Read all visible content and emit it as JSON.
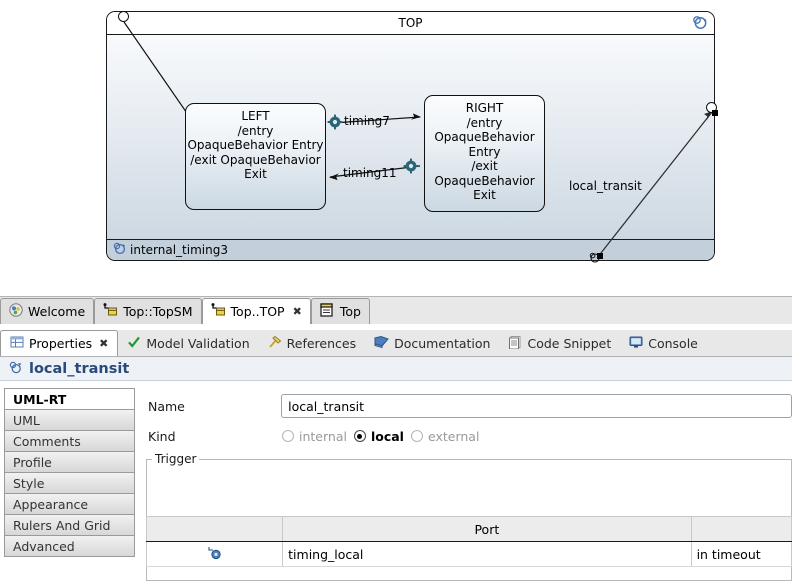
{
  "diagram": {
    "frame_title": "TOP",
    "frame_history_icon": "history-icon",
    "bottom_compartment": {
      "icon": "transition-icon",
      "label": "internal_timing3"
    },
    "states": [
      {
        "name": "state-left",
        "lines": [
          "LEFT",
          "/entry",
          "OpaqueBehavior Entry",
          "/exit OpaqueBehavior",
          "Exit"
        ]
      },
      {
        "name": "state-right",
        "lines": [
          "RIGHT",
          "/entry",
          "OpaqueBehavior",
          "Entry",
          "/exit",
          "OpaqueBehavior",
          "Exit"
        ]
      }
    ],
    "transitions": [
      {
        "label": "timing7",
        "icon": "gear-icon"
      },
      {
        "label": "timing11",
        "icon": "gear-icon"
      },
      {
        "label": "local_transit",
        "icon": "transition-icon",
        "selected": true
      }
    ],
    "initial_pseudostate": "initial-state-circle",
    "colors": {
      "frame_fill_top": "#fdfeff",
      "frame_fill_bottom": "#c3d0dc",
      "outline": "#1a1a1a",
      "gear": "#2b6676",
      "history": "#4a78b5"
    }
  },
  "editor_tabs": [
    {
      "label": "Welcome",
      "icon": "welcome-icon",
      "active": false,
      "closable": false
    },
    {
      "label": "Top::TopSM",
      "icon": "statemachine-icon",
      "active": false,
      "closable": false
    },
    {
      "label": "Top..TOP",
      "icon": "statemachine-icon",
      "active": true,
      "closable": true
    },
    {
      "label": "Top",
      "icon": "class-icon",
      "active": false,
      "closable": false
    }
  ],
  "properties_tabs": [
    {
      "label": "Properties",
      "icon": "properties-icon",
      "active": true,
      "closable": true
    },
    {
      "label": "Model Validation",
      "icon": "check-icon",
      "active": false,
      "closable": false
    },
    {
      "label": "References",
      "icon": "references-icon",
      "active": false,
      "closable": false
    },
    {
      "label": "Documentation",
      "icon": "book-icon",
      "active": false,
      "closable": false
    },
    {
      "label": "Code Snippet",
      "icon": "code-icon",
      "active": false,
      "closable": false
    },
    {
      "label": "Console",
      "icon": "console-icon",
      "active": false,
      "closable": false
    }
  ],
  "properties": {
    "header": {
      "icon": "transition-icon",
      "title": "local_transit"
    },
    "side_tabs": [
      {
        "label": "UML-RT",
        "selected": true
      },
      {
        "label": "UML",
        "selected": false
      },
      {
        "label": "Comments",
        "selected": false
      },
      {
        "label": "Profile",
        "selected": false
      },
      {
        "label": "Style",
        "selected": false
      },
      {
        "label": "Appearance",
        "selected": false
      },
      {
        "label": "Rulers And Grid",
        "selected": false
      },
      {
        "label": "Advanced",
        "selected": false
      }
    ],
    "form": {
      "name_label": "Name",
      "name_value": "local_transit",
      "name_placeholder": "",
      "kind_label": "Kind",
      "kind_options": [
        {
          "label": "internal",
          "selected": false,
          "enabled": false
        },
        {
          "label": "local",
          "selected": true,
          "enabled": true
        },
        {
          "label": "external",
          "selected": false,
          "enabled": false
        }
      ]
    },
    "trigger": {
      "legend": "Trigger",
      "columns": [
        "",
        "Port",
        ""
      ],
      "rows": [
        {
          "icon": "trigger-icon",
          "port": "timing_local",
          "timeout": "in timeout"
        }
      ]
    }
  }
}
